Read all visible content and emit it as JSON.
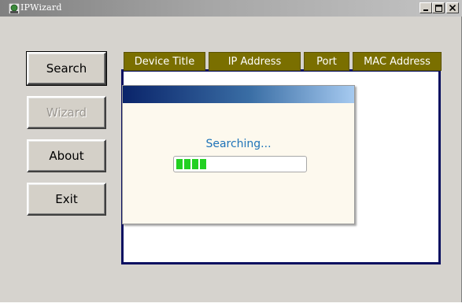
{
  "window": {
    "title": "IPWizard",
    "icon": "network-globe-icon",
    "controls": [
      "minimize",
      "restore",
      "close"
    ]
  },
  "sidebar": {
    "buttons": [
      {
        "label": "Search",
        "state": "default"
      },
      {
        "label": "Wizard",
        "state": "disabled"
      },
      {
        "label": "About",
        "state": "normal"
      },
      {
        "label": "Exit",
        "state": "normal"
      }
    ]
  },
  "device_list": {
    "columns": [
      "Device Title",
      "IP Address",
      "Port",
      "MAC Address"
    ],
    "rows": []
  },
  "progress_dialog": {
    "status_text": "Searching...",
    "progress_fraction": 0.25,
    "colors": {
      "fill": "#22d022",
      "status": "#1e73b8"
    }
  }
}
